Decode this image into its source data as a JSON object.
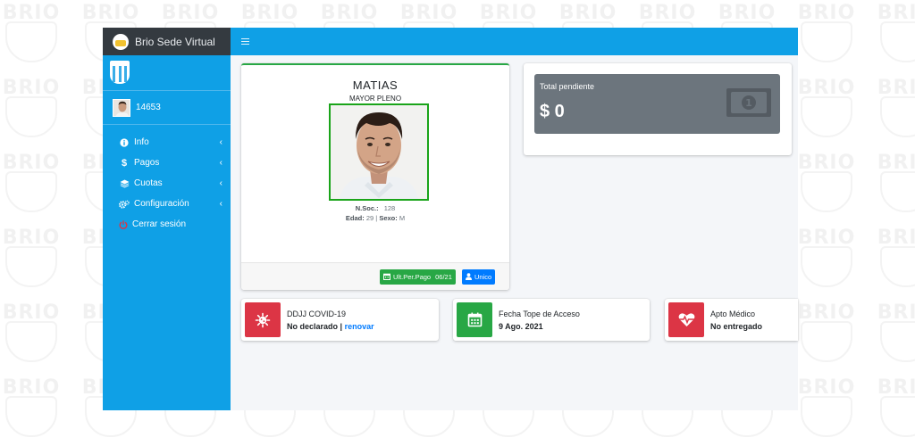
{
  "watermark": {
    "text": "BRIO"
  },
  "sidebar": {
    "brand": "Brio Sede Virtual",
    "user_id": "14653",
    "items": [
      {
        "label": "Info",
        "icon": "info-icon"
      },
      {
        "label": "Pagos",
        "icon": "dollar-icon"
      },
      {
        "label": "Cuotas",
        "icon": "layers-icon"
      },
      {
        "label": "Configuración",
        "icon": "cogs-icon"
      },
      {
        "label": "Cerrar sesión",
        "icon": "power-icon"
      }
    ]
  },
  "profile": {
    "name": "MATIAS",
    "category": "MAYOR PLENO",
    "nsoc_label": "N.Soc.:",
    "nsoc_value": "128",
    "edad_label": "Edad:",
    "edad_value": "29",
    "separator": "|",
    "sexo_label": "Sexo:",
    "sexo_value": "M",
    "last_payment_label": "Ult.Per.Pago",
    "last_payment_value": "06/21",
    "type_label": "Unico"
  },
  "pending": {
    "title": "Total pendiente",
    "value": "$ 0"
  },
  "info_boxes": {
    "covid": {
      "title": "DDJJ COVID-19",
      "value": "No declarado",
      "separator": "|",
      "link": "renovar",
      "color": "#dc3545"
    },
    "access": {
      "title": "Fecha Tope de Acceso",
      "value": "9 Ago. 2021",
      "color": "#28a745"
    },
    "medical": {
      "title": "Apto Médico",
      "value": "No entregado",
      "color": "#dc3545"
    }
  },
  "colors": {
    "sidebar": "#0fa0e6",
    "brand_bar": "#343a40",
    "content_bg": "#f4f6f9",
    "pending_box": "#6c757d"
  }
}
